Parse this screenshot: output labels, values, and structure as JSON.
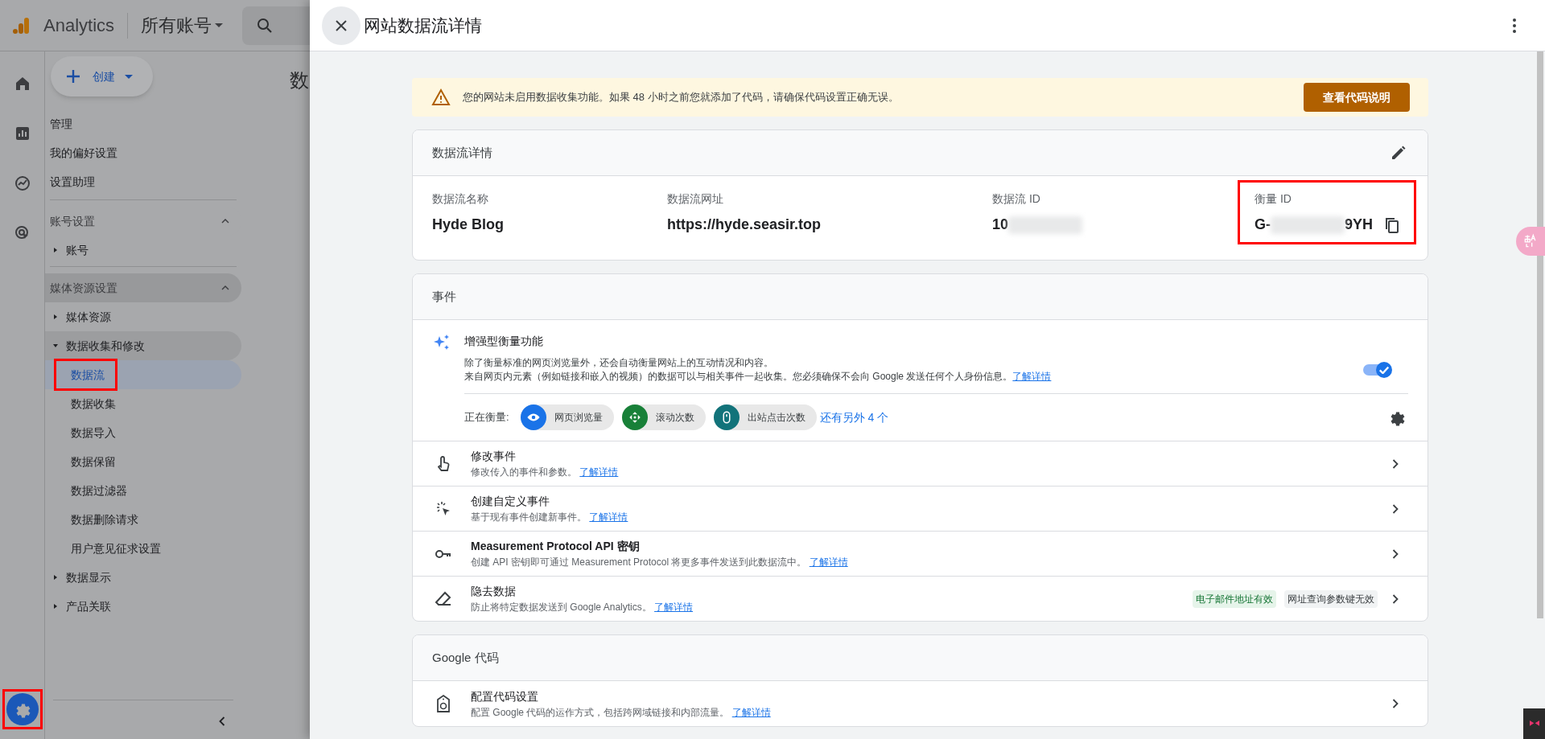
{
  "app": {
    "product": "Analytics",
    "account_selector": "所有账号"
  },
  "rail": [
    {
      "kind": "home",
      "selected": false,
      "highlighted": false
    },
    {
      "kind": "reports",
      "selected": false,
      "highlighted": false
    },
    {
      "kind": "explore",
      "selected": false,
      "highlighted": false
    },
    {
      "kind": "advertising",
      "selected": false,
      "highlighted": false
    },
    {
      "kind": "admin",
      "selected": true,
      "highlighted": true
    }
  ],
  "create_button": "创建",
  "nav": {
    "items": [
      {
        "label": "管理"
      },
      {
        "label": "我的偏好设置"
      },
      {
        "label": "设置助理"
      }
    ],
    "sections": [
      {
        "title": "账号设置",
        "expanded": true,
        "active": false,
        "items": [
          {
            "label": "账号",
            "expanded": false,
            "active": false
          }
        ]
      },
      {
        "title": "媒体资源设置",
        "expanded": true,
        "active": true,
        "items": [
          {
            "label": "媒体资源",
            "expanded": false,
            "active": false
          },
          {
            "label": "数据收集和修改",
            "expanded": true,
            "active": true,
            "children": [
              {
                "label": "数据流",
                "selected": true,
                "highlighted": true
              },
              {
                "label": "数据收集",
                "selected": false,
                "highlighted": false
              },
              {
                "label": "数据导入",
                "selected": false,
                "highlighted": false
              },
              {
                "label": "数据保留",
                "selected": false,
                "highlighted": false
              },
              {
                "label": "数据过滤器",
                "selected": false,
                "highlighted": false
              },
              {
                "label": "数据删除请求",
                "selected": false,
                "highlighted": false
              },
              {
                "label": "用户意见征求设置",
                "selected": false,
                "highlighted": false
              }
            ]
          },
          {
            "label": "数据显示",
            "expanded": false,
            "active": false
          },
          {
            "label": "产品关联",
            "expanded": false,
            "active": false
          }
        ]
      }
    ]
  },
  "main_title": "数",
  "drawer": {
    "title": "网站数据流详情",
    "alert": {
      "text": "您的网站未启用数据收集功能。如果 48 小时之前您就添加了代码，请确保代码设置正确无误。",
      "button": "查看代码说明"
    },
    "stream_details": {
      "title": "数据流详情",
      "fields": [
        {
          "label": "数据流名称",
          "value": "Hyde Blog",
          "redacted": false,
          "copyable": false,
          "highlighted": false
        },
        {
          "label": "数据流网址",
          "value": "https://hyde.seasir.top",
          "redacted": false,
          "copyable": false,
          "highlighted": false
        },
        {
          "label": "数据流 ID",
          "value": "10",
          "redacted": true,
          "copyable": false,
          "highlighted": false
        },
        {
          "label": "衡量 ID",
          "value": "G-",
          "value_end": "9YH",
          "redacted": true,
          "copyable": true,
          "highlighted": true
        }
      ]
    },
    "events": {
      "title": "事件",
      "enhanced": {
        "title": "增强型衡量功能",
        "description": [
          "除了衡量标准的网页浏览量外，还会自动衡量网站上的互动情况和内容。",
          "来自网页内元素（例如链接和嵌入的视频）的数据可以与相关事件一起收集。您必须确保不会向 Google 发送任何个人身份信息。"
        ],
        "link": "了解详情",
        "on": true,
        "measuring_label": "正在衡量:",
        "chips": [
          {
            "kind": "eye",
            "label": "网页浏览量",
            "color": "#1a73e8"
          },
          {
            "kind": "scroll",
            "label": "滚动次数",
            "color": "#188038"
          },
          {
            "kind": "mouse",
            "label": "出站点击次数",
            "color": "#12737a"
          }
        ],
        "more": "还有另外 4 个"
      },
      "rows": [
        {
          "kind": "touch",
          "title": "修改事件",
          "description": "修改传入的事件和参数。",
          "link": "了解详情"
        },
        {
          "kind": "click",
          "title": "创建自定义事件",
          "description": "基于现有事件创建新事件。",
          "link": "了解详情"
        },
        {
          "kind": "key",
          "title": "Measurement Protocol API 密钥",
          "description": "创建 API 密钥即可通过 Measurement Protocol 将更多事件发送到此数据流中。",
          "link": "了解详情"
        },
        {
          "kind": "eraser",
          "title": "隐去数据",
          "description": "防止将特定数据发送到 Google Analytics。",
          "link": "了解详情",
          "badges": [
            {
              "label": "电子邮件地址有效",
              "on": true
            },
            {
              "label": "网址查询参数键无效",
              "on": false
            }
          ]
        }
      ]
    },
    "google_tag": {
      "title": "Google 代码",
      "rows": [
        {
          "kind": "tag",
          "title": "配置代码设置",
          "description": "配置 Google 代码的运作方式，包括跨网域链接和内部流量。",
          "link": "了解详情"
        }
      ]
    }
  }
}
